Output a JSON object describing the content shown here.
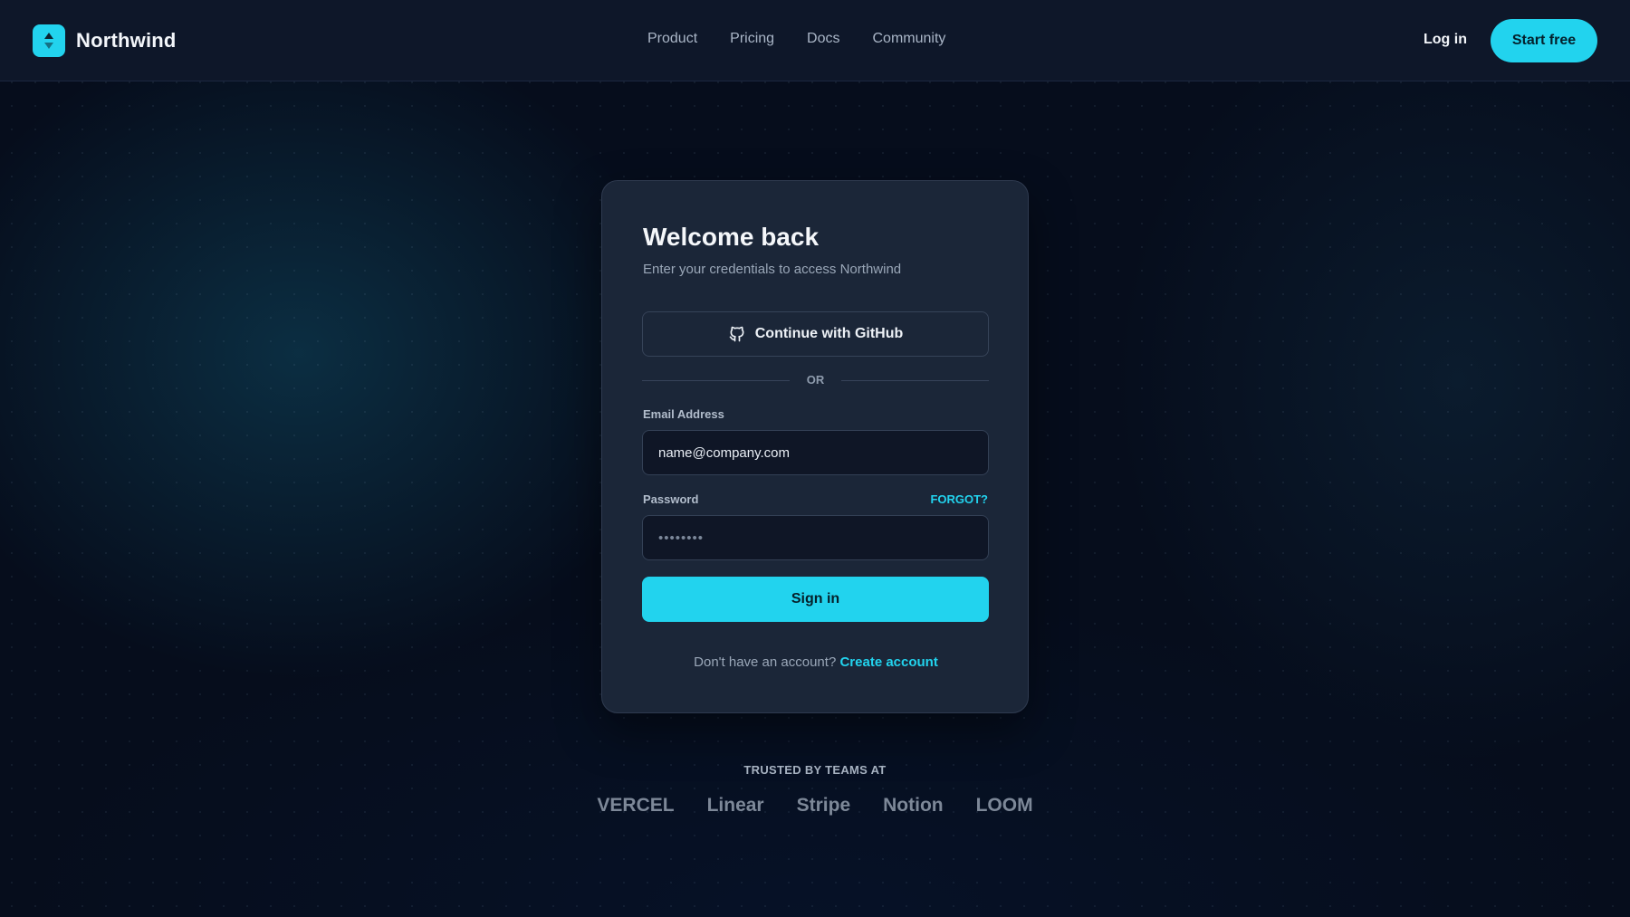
{
  "nav": {
    "brand": "Northwind",
    "links": [
      "Product",
      "Pricing",
      "Docs",
      "Community"
    ],
    "login": "Log in",
    "cta": "Start free"
  },
  "card": {
    "title": "Welcome back",
    "subtitle": "Enter your credentials to access Northwind",
    "github_button": "Continue with GitHub",
    "divider": "OR",
    "email_label": "Email Address",
    "email_placeholder": "name@company.com",
    "password_label": "Password",
    "password_placeholder": "••••••••",
    "forgot": "FORGOT?",
    "signin": "Sign in",
    "no_account": "Don't have an account?",
    "create_account": "Create account"
  },
  "trusted": {
    "heading": "TRUSTED BY TEAMS AT",
    "logos": [
      "VERCEL",
      "Linear",
      "Stripe",
      "Notion",
      "LOOM"
    ]
  },
  "icons": {
    "brand_logo": "up-down-arrows-icon",
    "github": "github-icon"
  },
  "colors": {
    "accent": "#22d3ee",
    "background": "#060d1c",
    "card": "#1b2638",
    "nav": "#0e1729"
  }
}
